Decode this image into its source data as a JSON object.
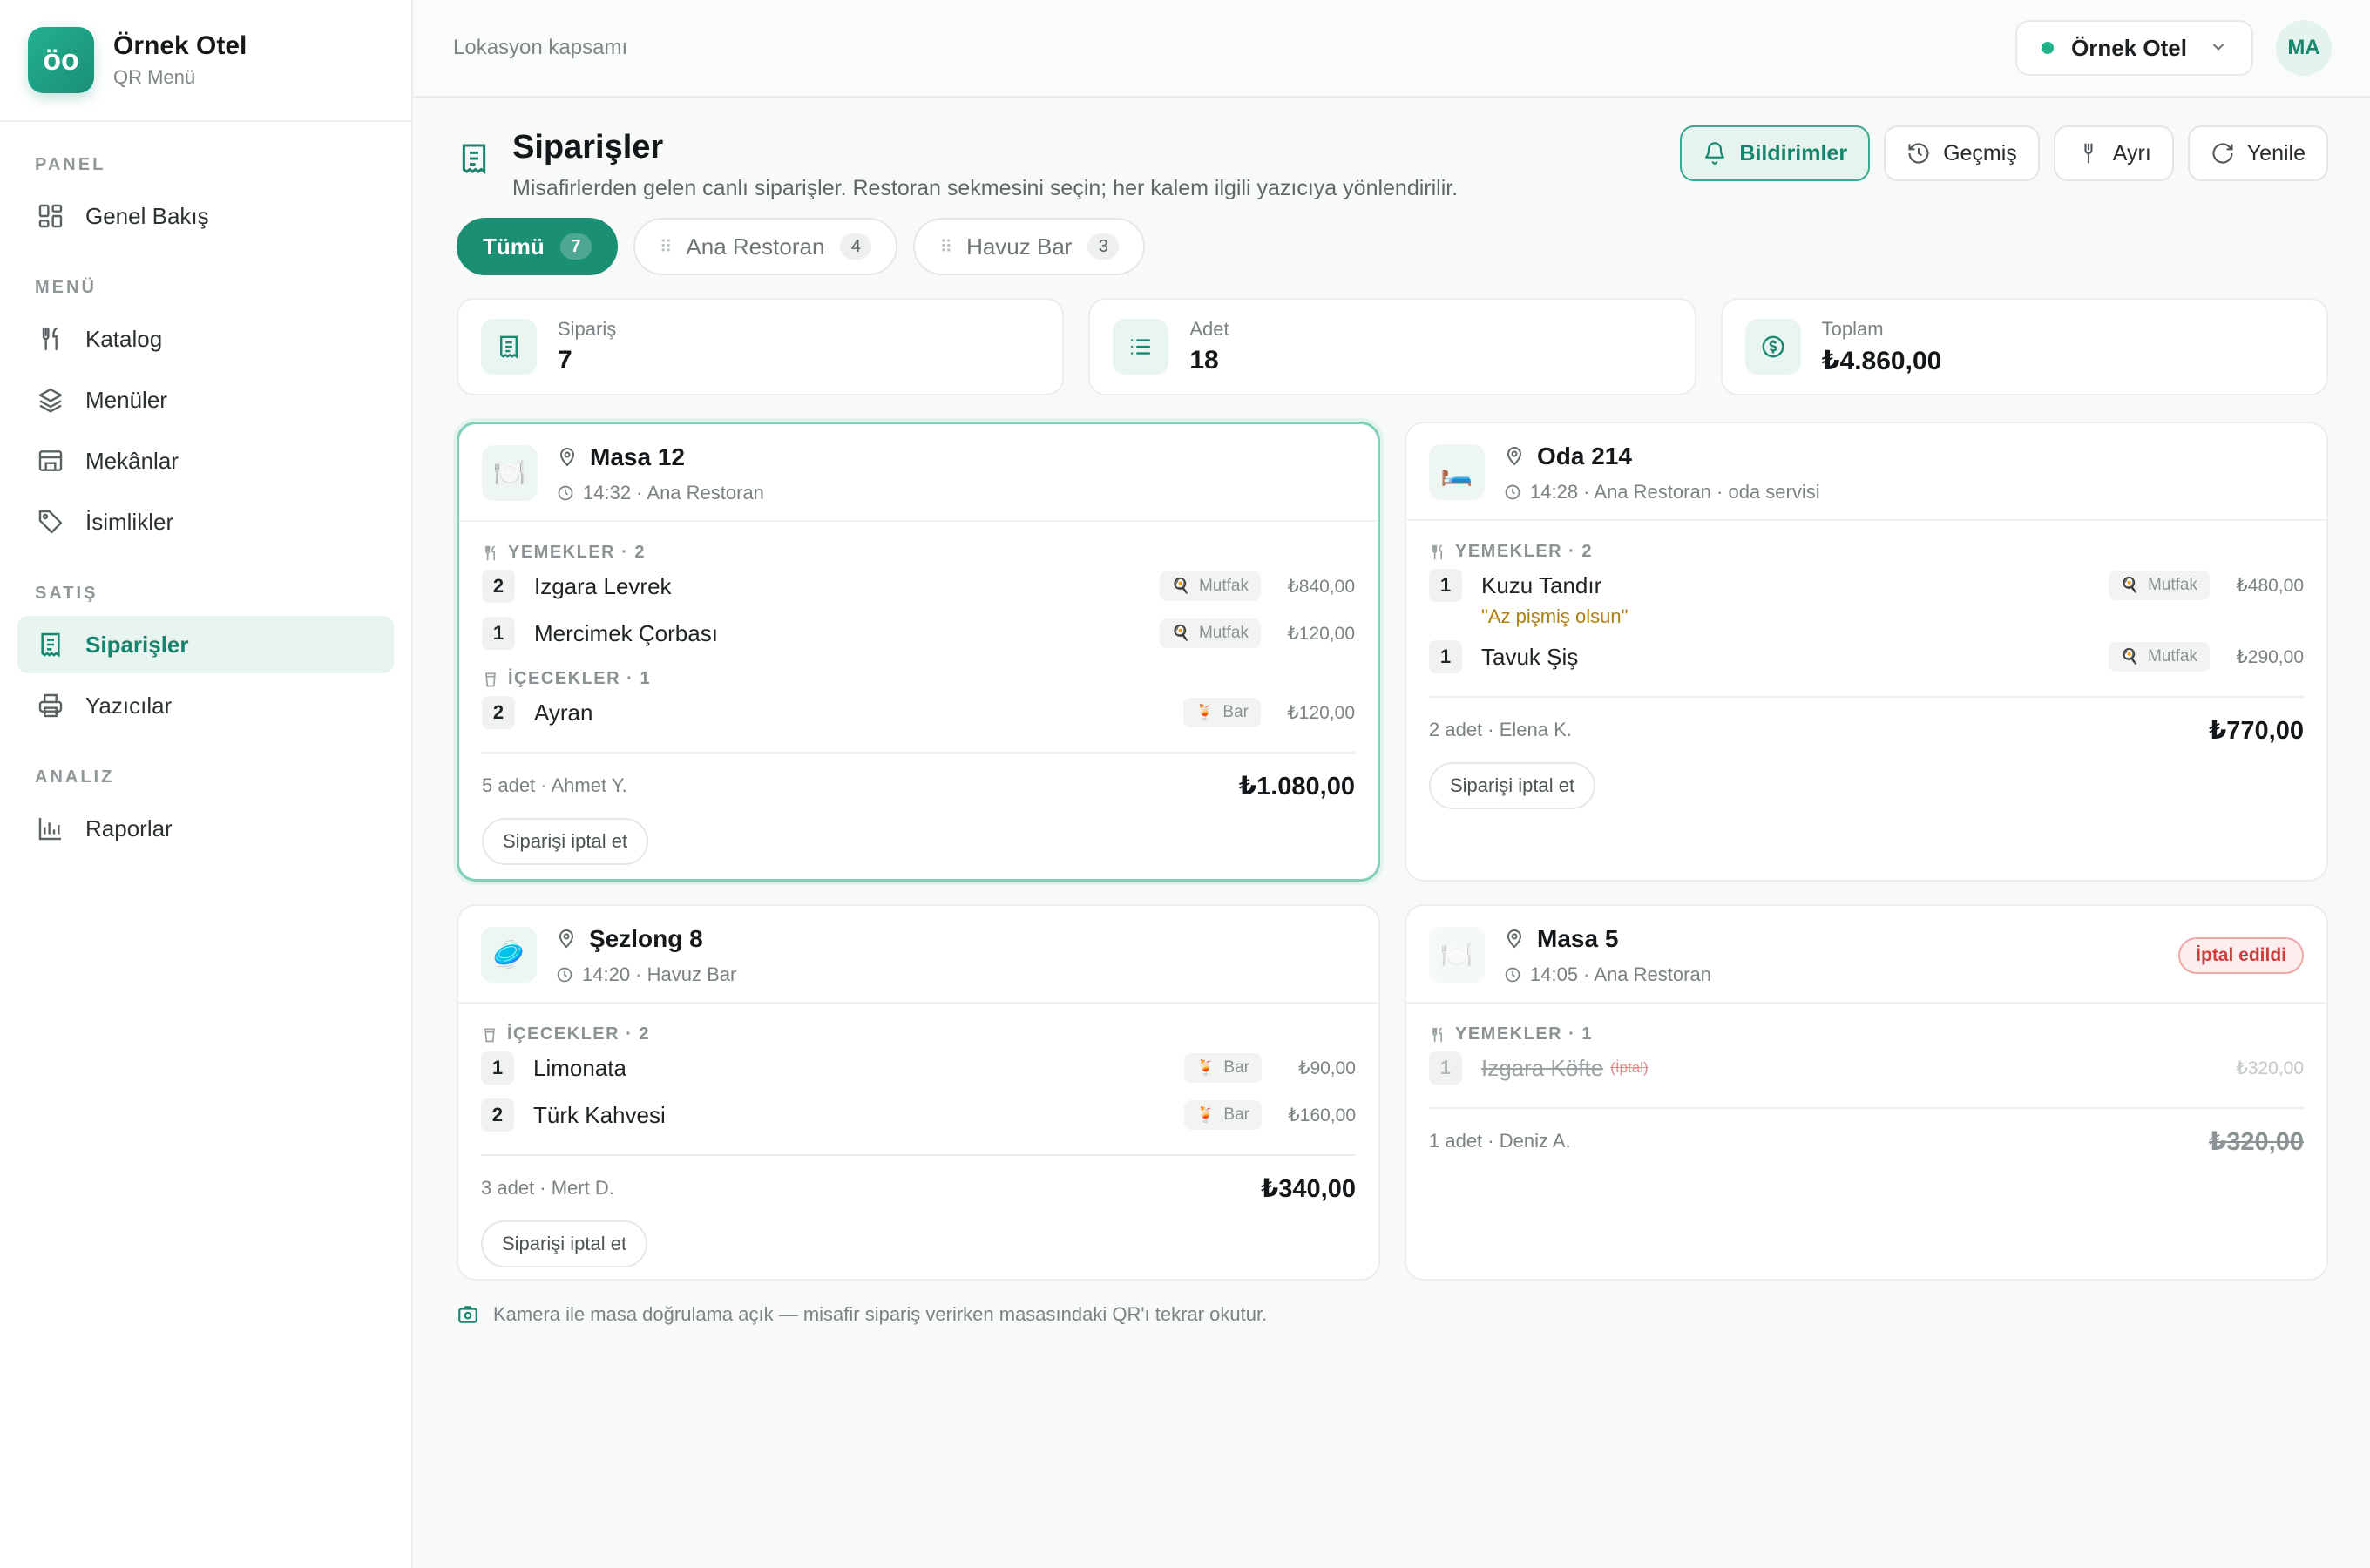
{
  "brand": {
    "logo": "öo",
    "name": "Örnek Otel",
    "subtitle": "QR Menü"
  },
  "sidebar": {
    "sections": [
      {
        "title": "PANEL",
        "items": [
          {
            "label": "Genel Bakış",
            "icon": "dashboard-icon"
          }
        ]
      },
      {
        "title": "MENÜ",
        "items": [
          {
            "label": "Katalog",
            "icon": "cutlery-icon"
          },
          {
            "label": "Menüler",
            "icon": "layers-icon"
          },
          {
            "label": "Mekânlar",
            "icon": "store-icon"
          },
          {
            "label": "İsimlikler",
            "icon": "tag-icon"
          }
        ]
      },
      {
        "title": "SATIŞ",
        "items": [
          {
            "label": "Siparişler",
            "icon": "receipt-icon",
            "active": true
          },
          {
            "label": "Yazıcılar",
            "icon": "printer-icon"
          }
        ]
      },
      {
        "title": "ANALIZ",
        "items": [
          {
            "label": "Raporlar",
            "icon": "bar-chart-icon"
          }
        ]
      }
    ]
  },
  "topbar": {
    "scope": "Lokasyon kapsamı",
    "venue": "Örnek Otel",
    "avatar": "MA"
  },
  "page": {
    "title": "Siparişler",
    "description": "Misafirlerden gelen canlı siparişler. Restoran sekmesini seçin; her kalem ilgili yazıcıya yönlendirilir.",
    "actions": {
      "notifications": "Bildirimler",
      "history": "Geçmiş",
      "split": "Ayrı",
      "refresh": "Yenile"
    }
  },
  "tabs": [
    {
      "label": "Tümü",
      "count": "7"
    },
    {
      "label": "Ana Restoran",
      "count": "4"
    },
    {
      "label": "Havuz Bar",
      "count": "3"
    }
  ],
  "stats": [
    {
      "label": "Sipariş",
      "value": "7"
    },
    {
      "label": "Adet",
      "value": "18"
    },
    {
      "label": "Toplam",
      "value": "₺4.860,00"
    }
  ],
  "orders": [
    {
      "title": "Masa 12",
      "meta": "14:32 · Ana Restoran",
      "emoji": "🍽️",
      "groups": [
        {
          "label": "YEMEKLER · 2",
          "items": [
            {
              "qty": "2",
              "name": "Izgara Levrek",
              "station": "Mutfak",
              "price": "₺840,00"
            },
            {
              "qty": "1",
              "name": "Mercimek Çorbası",
              "station": "Mutfak",
              "price": "₺120,00"
            }
          ]
        },
        {
          "label": "İÇECEKLER · 1",
          "items": [
            {
              "qty": "2",
              "name": "Ayran",
              "station": "Bar",
              "price": "₺120,00"
            }
          ]
        }
      ],
      "footer": "5 adet · Ahmet Y.",
      "total": "₺1.080,00",
      "cancel": "Siparişi iptal et"
    },
    {
      "title": "Oda 214",
      "meta": "14:28 · Ana Restoran · oda servisi",
      "emoji": "🛏️",
      "groups": [
        {
          "label": "YEMEKLER · 2",
          "items": [
            {
              "qty": "1",
              "name": "Kuzu Tandır",
              "station": "Mutfak",
              "price": "₺480,00",
              "note": "\"Az pişmiş olsun\""
            },
            {
              "qty": "1",
              "name": "Tavuk Şiş",
              "station": "Mutfak",
              "price": "₺290,00"
            }
          ]
        }
      ],
      "footer": "2 adet · Elena K.",
      "total": "₺770,00",
      "cancel": "Siparişi iptal et"
    },
    {
      "title": "Şezlong 8",
      "meta": "14:20 · Havuz Bar",
      "emoji": "🥏",
      "groups": [
        {
          "label": "İÇECEKLER · 2",
          "items": [
            {
              "qty": "1",
              "name": "Limonata",
              "station": "Bar",
              "price": "₺90,00"
            },
            {
              "qty": "2",
              "name": "Türk Kahvesi",
              "station": "Bar",
              "price": "₺160,00"
            }
          ]
        }
      ],
      "footer": "3 adet · Mert D.",
      "total": "₺340,00",
      "cancel": "Siparişi iptal et"
    },
    {
      "title": "Masa 5",
      "meta": "14:05 · Ana Restoran",
      "emoji": "🍽️",
      "status": "İptal edildi",
      "groups": [
        {
          "label": "YEMEKLER · 1",
          "items": [
            {
              "qty": "1",
              "name": "Izgara Köfte",
              "tag": "(İptal)",
              "price": "₺320,00"
            }
          ]
        }
      ],
      "footer": "1 adet · Deniz A.",
      "total": "₺320,00"
    }
  ],
  "footer_note": "Kamera ile masa doğrulama açık — misafir sipariş verirken masasındaki QR'ı tekrar okutur.",
  "colors": {
    "accent": "#1b8f74",
    "accent_light": "#e7f4f0",
    "danger": "#d13d3d",
    "note": "#b07d10"
  }
}
